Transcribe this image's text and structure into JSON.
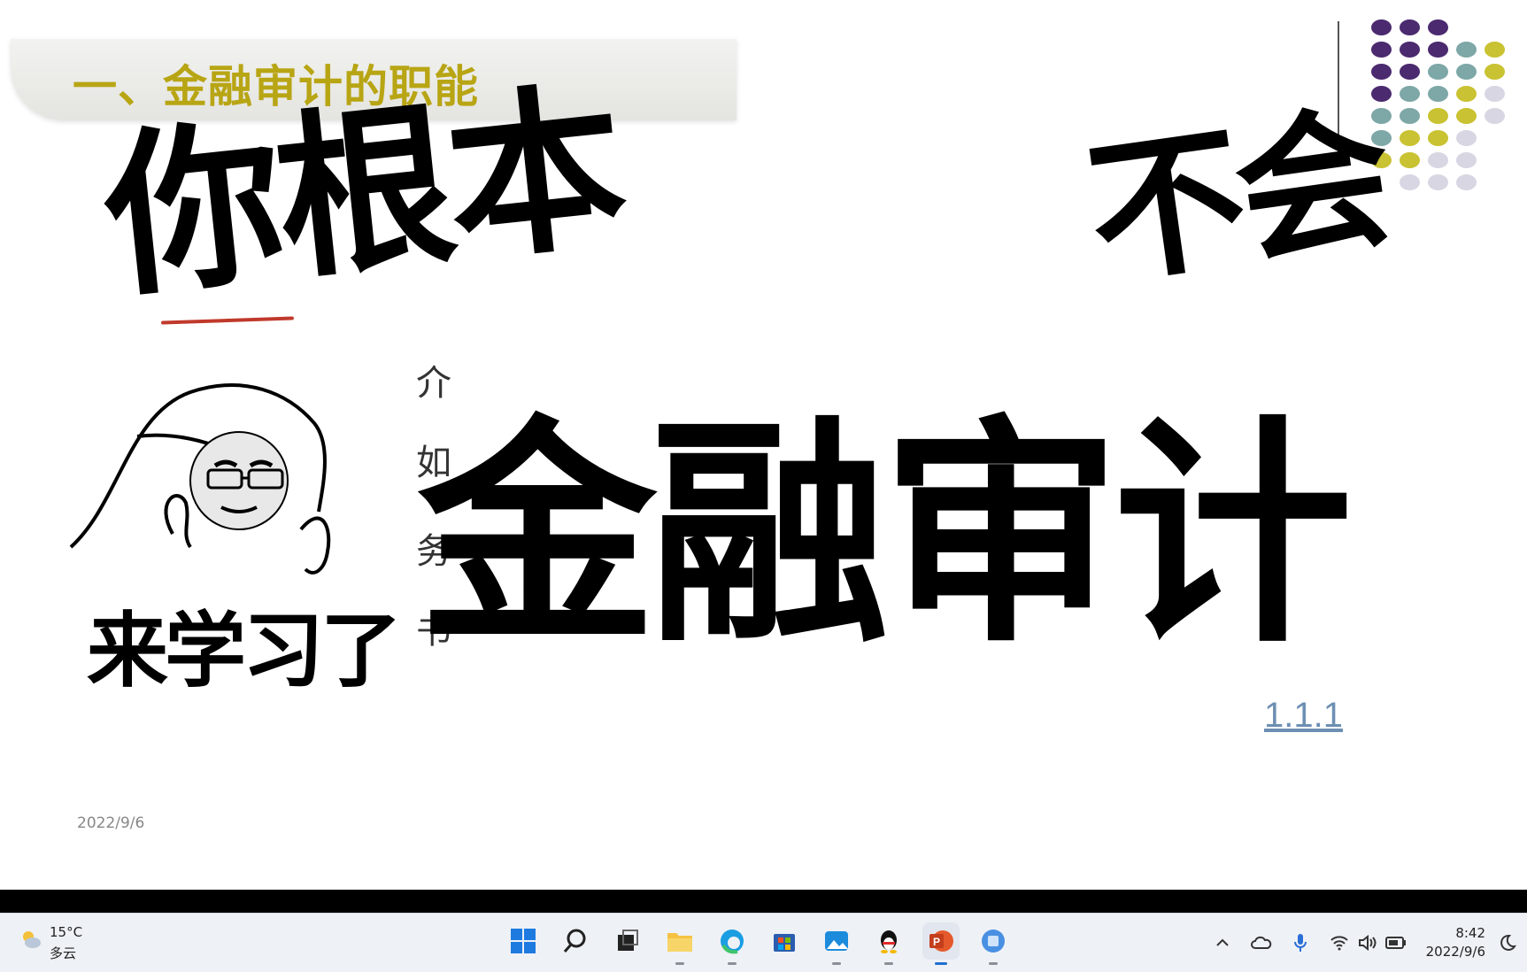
{
  "slide": {
    "title": "一、金融审计的职能",
    "date": "2022/9/6",
    "link": "1.1.1",
    "partial_chars": [
      "介",
      "如",
      "务",
      "书"
    ]
  },
  "overlay": {
    "line1": "你根本",
    "line2": "不会",
    "line3": "金融审计",
    "caption": "来学习了"
  },
  "decor": {
    "dot_colors": [
      "#4b2a6f",
      "#7ea7a7",
      "#c9c232",
      "#d9d6e3"
    ]
  },
  "taskbar": {
    "weather": {
      "temp": "15°C",
      "condition": "多云",
      "icon": "partly-cloudy-icon"
    },
    "apps": [
      {
        "name": "start-button",
        "icon": "windows-logo-icon"
      },
      {
        "name": "search-button",
        "icon": "search-icon"
      },
      {
        "name": "task-view-button",
        "icon": "task-view-icon"
      },
      {
        "name": "file-explorer-button",
        "icon": "folder-icon"
      },
      {
        "name": "edge-button",
        "icon": "edge-icon"
      },
      {
        "name": "store-button",
        "icon": "store-icon"
      },
      {
        "name": "photos-button",
        "icon": "photos-icon"
      },
      {
        "name": "qq-button",
        "icon": "penguin-icon"
      },
      {
        "name": "powerpoint-button",
        "icon": "powerpoint-icon",
        "active": true
      },
      {
        "name": "app-button",
        "icon": "app-icon"
      }
    ],
    "tray": {
      "icons": [
        "chevron-up-icon",
        "cloud-icon",
        "microphone-icon",
        "wifi-icon",
        "volume-icon",
        "battery-icon"
      ],
      "time": "8:42",
      "date": "2022/9/6",
      "moon_icon": "do-not-disturb-icon"
    }
  }
}
